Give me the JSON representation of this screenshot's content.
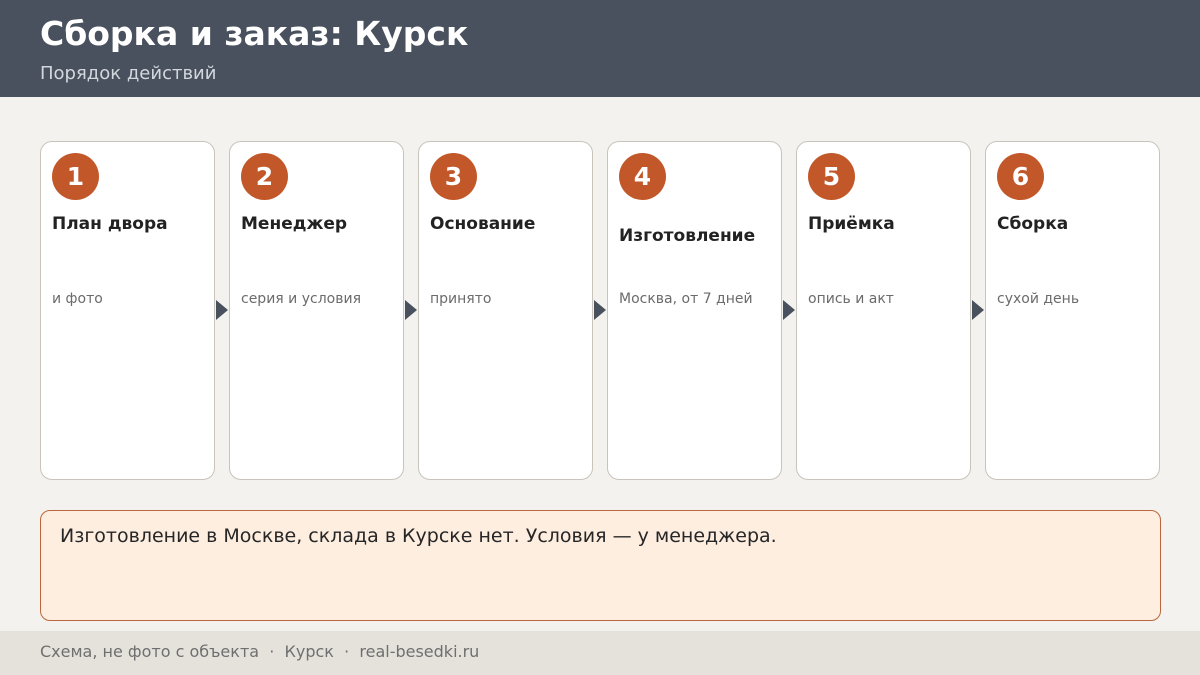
{
  "header": {
    "title": "Сборка и заказ: Курск",
    "subtitle": "Порядок действий"
  },
  "steps": [
    {
      "number": "1",
      "title": "План двора",
      "description": "и фото"
    },
    {
      "number": "2",
      "title": "Менеджер",
      "description": "серия и условия"
    },
    {
      "number": "3",
      "title": "Основание",
      "description": "принято"
    },
    {
      "number": "4",
      "title": "Изготовление",
      "description": "Москва, от 7 дней"
    },
    {
      "number": "5",
      "title": "Приёмка",
      "description": "опись и акт"
    },
    {
      "number": "6",
      "title": "Сборка",
      "description": "сухой день"
    }
  ],
  "note": {
    "text": "Изготовление в Москве, склада в Курске нет. Условия — у менеджера."
  },
  "footer": {
    "text": "Схема, не фото с объекта  ·  Курск  ·  real-besedki.ru"
  },
  "colors": {
    "header_bg": "#48515d",
    "accent": "#c2582a",
    "note_bg": "#fdeee0",
    "note_border": "#b8683c",
    "arrow": "#48515d"
  }
}
